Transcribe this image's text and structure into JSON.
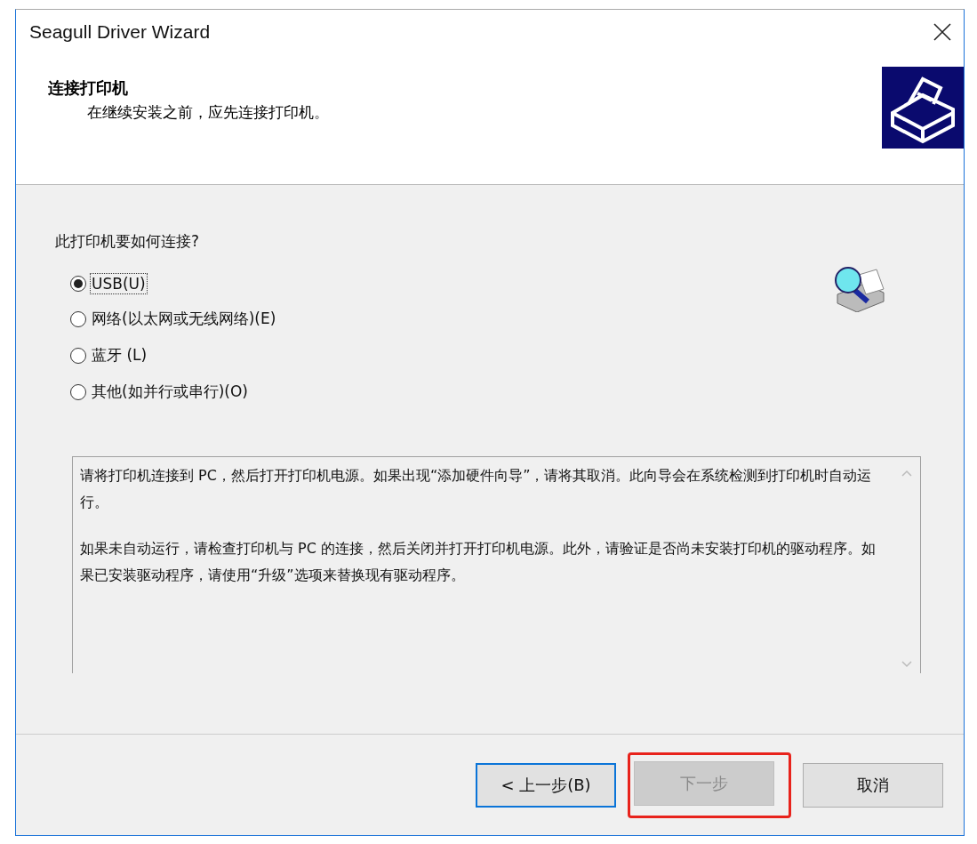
{
  "window": {
    "title": "Seagull Driver Wizard"
  },
  "header": {
    "title": "连接打印机",
    "subtitle": "在继续安装之前，应先连接打印机。"
  },
  "question": "此打印机要如何连接?",
  "options": [
    {
      "label": "USB(U)",
      "selected": true
    },
    {
      "label": "网络(以太网或无线网络)(E)",
      "selected": false
    },
    {
      "label": "蓝牙 (L)",
      "selected": false
    },
    {
      "label": "其他(如并行或串行)(O)",
      "selected": false
    }
  ],
  "info_text": [
    "请将打印机连接到 PC，然后打开打印机电源。如果出现“添加硬件向导”，请将其取消。此向导会在系统检测到打印机时自动运行。",
    "如果未自动运行，请检查打印机与 PC 的连接，然后关闭并打开打印机电源。此外，请验证是否尚未安装打印机的驱动程序。如果已安装驱动程序，请使用“升级”选项来替换现有驱动程序。"
  ],
  "buttons": [
    {
      "label": "< 上一步(B)",
      "disabled": false,
      "focused": true,
      "annotated": false
    },
    {
      "label": "下一步",
      "disabled": true,
      "focused": false,
      "annotated": true
    },
    {
      "label": "取消",
      "disabled": false,
      "focused": false,
      "annotated": false
    }
  ]
}
